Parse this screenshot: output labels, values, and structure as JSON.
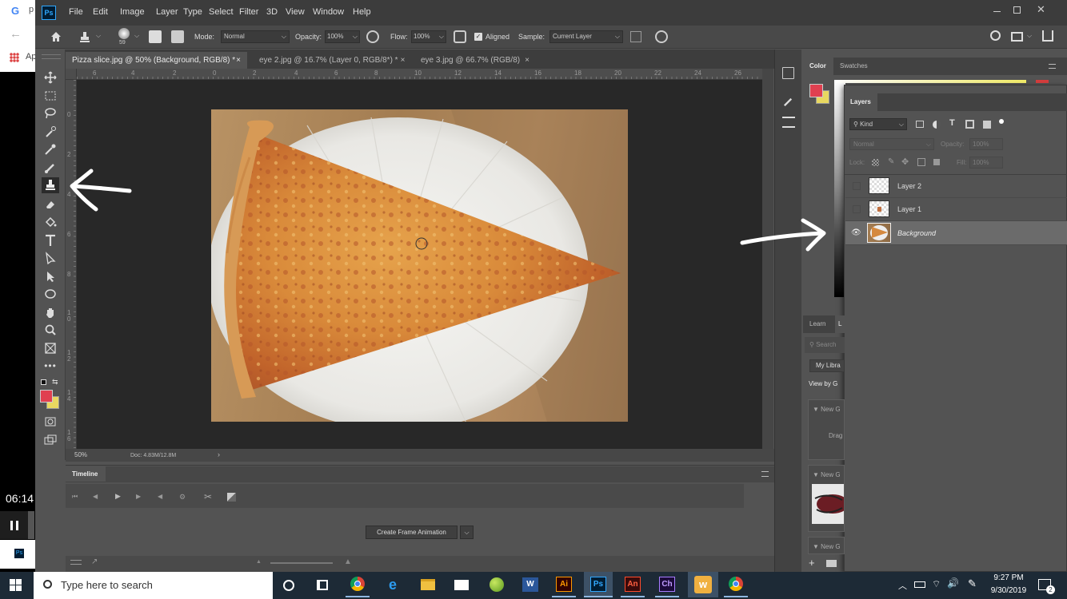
{
  "browser": {
    "address_stub": "Ap",
    "back": "←"
  },
  "menu": [
    "File",
    "Edit",
    "Image",
    "Layer",
    "Type",
    "Select",
    "Filter",
    "3D",
    "View",
    "Window",
    "Help"
  ],
  "ps_logo": "Ps",
  "options": {
    "brush_size": "59",
    "mode_label": "Mode:",
    "mode_value": "Normal",
    "opacity_label": "Opacity:",
    "opacity_value": "100%",
    "flow_label": "Flow:",
    "flow_value": "100%",
    "aligned_label": "Aligned",
    "sample_label": "Sample:",
    "sample_value": "Current Layer"
  },
  "doc_tabs": [
    {
      "label": "Pizza slice.jpg @ 50% (Background, RGB/8) *",
      "close": "×"
    },
    {
      "label": "eye 2.jpg @ 16.7% (Layer 0, RGB/8*) *",
      "close": "×"
    },
    {
      "label": "eye 3.jpg @ 66.7% (RGB/8)",
      "close": "×"
    }
  ],
  "ruler_top": [
    "6",
    "4",
    "2",
    "0",
    "2",
    "4",
    "6",
    "8",
    "10",
    "12",
    "14",
    "16",
    "18",
    "20",
    "22",
    "24",
    "26"
  ],
  "ruler_left": [
    "0",
    "2",
    "4",
    "6",
    "8",
    "1\n0",
    "1\n2",
    "1\n4",
    "1\n6"
  ],
  "status": {
    "zoom": "50%",
    "doc": "Doc: 4.83M/12.8M",
    "arrow": "›"
  },
  "timeline": {
    "title": "Timeline",
    "create_button": "Create Frame Animation"
  },
  "right_panel": {
    "color_tab": "Color",
    "swatches_tab": "Swatches",
    "learn_tab": "Learn",
    "libraries_tab": "L",
    "search_placeholder": "Search",
    "library_select": "My Libra",
    "view_by": "View by G",
    "new_group_1": "New G",
    "drag_text": "Drag",
    "new_group_2": "New G",
    "new_group_3": "New G"
  },
  "layers_panel": {
    "title": "Layers",
    "kind_filter": "Kind",
    "blend_mode": "Normal",
    "opacity_label": "Opacity:",
    "opacity_value": "100%",
    "lock_label": "Lock:",
    "fill_label": "Fill:",
    "fill_value": "100%",
    "layers": [
      {
        "name": "Layer 2",
        "visible": false,
        "selected": false
      },
      {
        "name": "Layer 1",
        "visible": false,
        "selected": false
      },
      {
        "name": "Background",
        "visible": true,
        "selected": true
      }
    ]
  },
  "video_overlay": {
    "time": "06:14",
    "pause": "II"
  },
  "taskbar": {
    "search_placeholder": "Type here to search",
    "apps": [
      "Ai",
      "Ps",
      "An",
      "Ch"
    ],
    "clock_time": "9:27 PM",
    "clock_date": "9/30/2019",
    "notification_count": "2"
  },
  "colors": {
    "foreground": "#e04050",
    "background": "#e8d860",
    "ps_bg": "#535353",
    "canvas_bg": "#282828"
  }
}
